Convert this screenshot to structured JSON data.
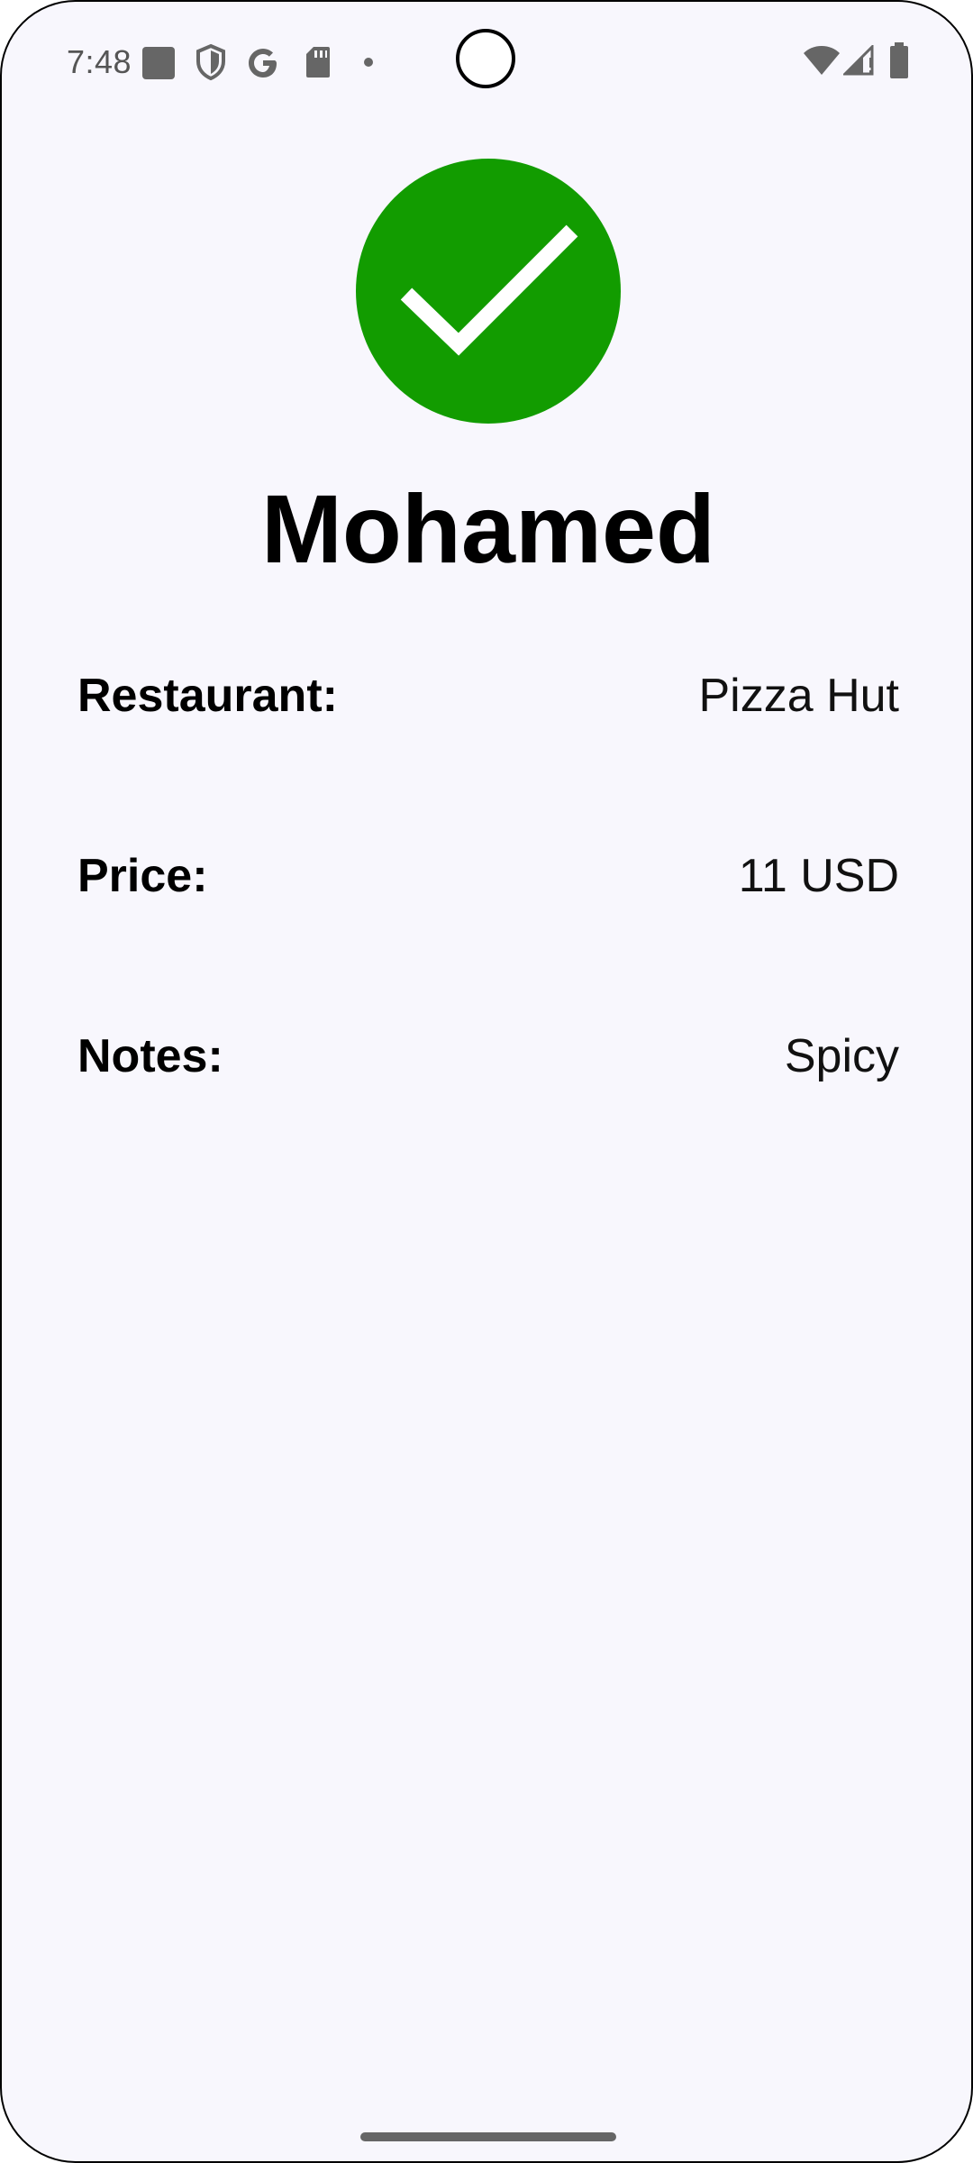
{
  "status_bar": {
    "time": "7:48",
    "icons_left": [
      "square-notification-icon",
      "shield-icon",
      "google-icon",
      "sd-card-icon",
      "dot-icon"
    ],
    "icons_right": [
      "wifi-icon",
      "signal-icon",
      "battery-icon"
    ]
  },
  "order": {
    "status_icon": "check-icon",
    "status_color": "#129c00",
    "name": "Mohamed",
    "details": [
      {
        "label": "Restaurant:",
        "value": "Pizza Hut"
      },
      {
        "label": "Price:",
        "value": "11 USD"
      },
      {
        "label": "Notes:",
        "value": "Spicy"
      }
    ]
  }
}
